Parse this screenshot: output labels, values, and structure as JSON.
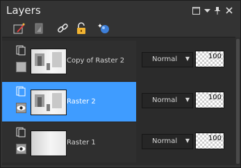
{
  "panel": {
    "title": "Layers"
  },
  "toolbar": {
    "icons": [
      "new-layer-icon",
      "layer-mask-icon",
      "link-icon",
      "lock-icon",
      "layer-effects-icon"
    ]
  },
  "layers": [
    {
      "name": "Copy of Raster 2",
      "blend_mode": "Normal",
      "opacity": "100",
      "selected": false
    },
    {
      "name": "Raster 2",
      "blend_mode": "Normal",
      "opacity": "100",
      "selected": true
    },
    {
      "name": "Raster 1",
      "blend_mode": "Normal",
      "opacity": "100",
      "selected": false
    }
  ],
  "colors": {
    "selection": "#3f9cff",
    "panel_bg": "#333333"
  }
}
